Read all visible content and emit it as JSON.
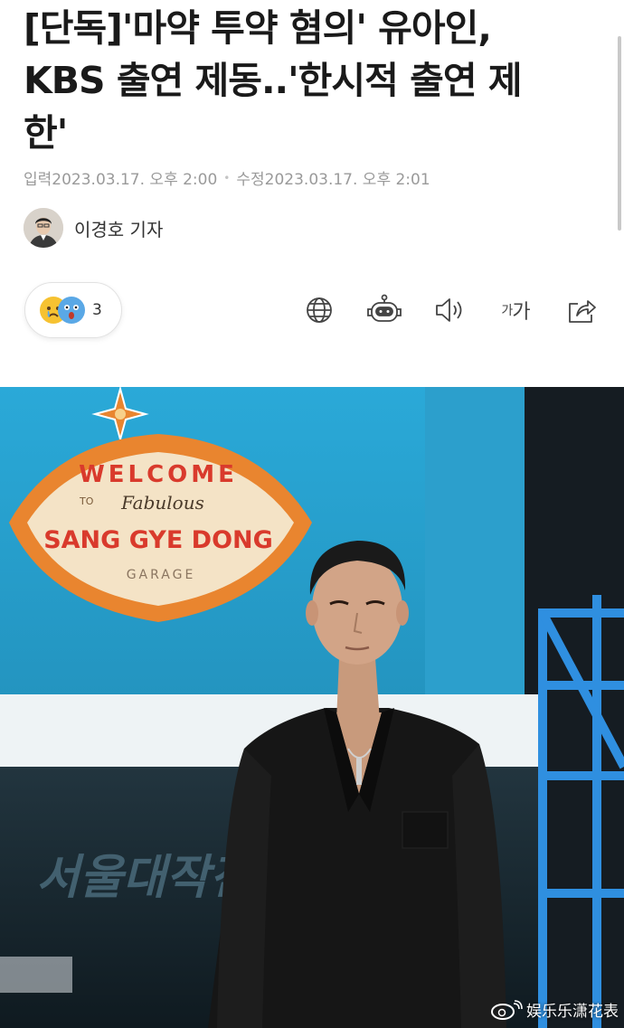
{
  "article": {
    "headline_line1": "[단독]'마약 투약 혐의' 유아인,",
    "headline_line2": "KBS 출연 제동..'한시적 출연 제",
    "headline_line3": "한'",
    "input_label": "입력",
    "input_date": "2023.03.17. 오후 2:00",
    "edit_label": "수정",
    "edit_date": "2023.03.17. 오후 2:01",
    "author": "이경호 기자"
  },
  "reactions": {
    "count": "3"
  },
  "toolbar": {
    "icons": [
      "globe-icon",
      "robot-icon",
      "speaker-icon",
      "font-size-icon",
      "share-icon"
    ],
    "font_small": "가",
    "font_large": "가"
  },
  "photo": {
    "sign_welcome": "WELCOME",
    "sign_to": "TO",
    "sign_fabulous": "Fabulous",
    "sign_name": "SANG GYE DONG",
    "sign_garage": "GARAGE",
    "backdrop_text": "서울대작전",
    "watermark": "娱乐乐潇花表",
    "watermark_icon": "weibo-icon"
  },
  "colors": {
    "accent_blue": "#2aa7d6",
    "sign_orange": "#e9852f",
    "text_gray": "#9a9a9a"
  }
}
